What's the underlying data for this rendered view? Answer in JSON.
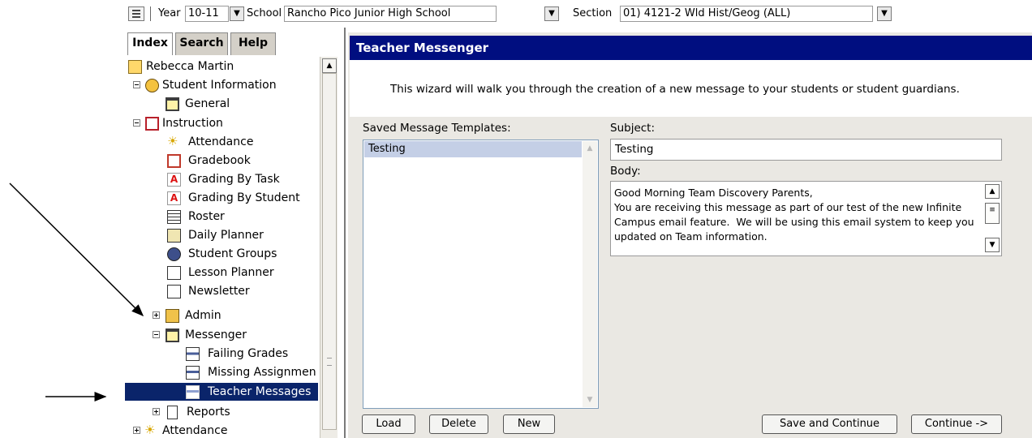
{
  "top_bar": {
    "year_label": "Year",
    "year_value": "10-11",
    "school_label": "School",
    "school_value": "Rancho Pico Junior High School",
    "section_label": "Section",
    "section_value": "01) 4121-2 Wld Hist/Geog (ALL)"
  },
  "nav_tabs": [
    "Index",
    "Search",
    "Help"
  ],
  "tree": [
    {
      "label": "Rebecca Martin",
      "icon": "user-icon"
    },
    {
      "label": "Student Information",
      "icon": "student-icon",
      "expander": "minus"
    },
    {
      "label": "General",
      "icon": "folder-icon"
    },
    {
      "label": "Instruction",
      "icon": "instruction-icon",
      "expander": "minus"
    },
    {
      "label": "Attendance",
      "icon": "sun-icon"
    },
    {
      "label": "Gradebook",
      "icon": "gradebook-icon"
    },
    {
      "label": "Grading By Task",
      "icon": "grade-a-icon"
    },
    {
      "label": "Grading By Student",
      "icon": "grade-a-icon"
    },
    {
      "label": "Roster",
      "icon": "roster-icon"
    },
    {
      "label": "Daily Planner",
      "icon": "planner-icon"
    },
    {
      "label": "Student Groups",
      "icon": "groups-icon"
    },
    {
      "label": "Lesson Planner",
      "icon": "note-pencil-icon"
    },
    {
      "label": "Newsletter",
      "icon": "note-pencil-icon"
    },
    {
      "label": "Admin",
      "icon": "admin-folder-icon",
      "expander": "plus"
    },
    {
      "label": "Messenger",
      "icon": "folder-icon",
      "expander": "minus"
    },
    {
      "label": "Failing Grades",
      "icon": "message-icon"
    },
    {
      "label": "Missing Assignmen",
      "icon": "message-icon"
    },
    {
      "label": "Teacher Messages",
      "icon": "message-icon",
      "selected": true
    },
    {
      "label": "Reports",
      "icon": "page-icon",
      "expander": "plus"
    },
    {
      "label": "Attendance",
      "icon": "sun-icon",
      "expander": "plus"
    }
  ],
  "panel": {
    "title": "Teacher Messenger",
    "intro": "This wizard will walk you through the creation of a new message to your students or student guardians.",
    "templates_label": "Saved Message Templates:",
    "templates": [
      "Testing"
    ],
    "subject_label": "Subject:",
    "subject_value": "Testing",
    "body_label": "Body:",
    "body_value": "Good Morning Team Discovery Parents,\nYou are receiving this message as part of our test of the new Infinite Campus email feature.  We will be using this email system to keep you updated on Team information.",
    "buttons": {
      "load": "Load",
      "delete": "Delete",
      "new": "New",
      "save_continue": "Save and Continue",
      "continue": "Continue ->"
    }
  },
  "colors": {
    "header_bg": "#000e80",
    "selection_bg": "#0a246a",
    "panel_bg": "#eae8e3"
  }
}
